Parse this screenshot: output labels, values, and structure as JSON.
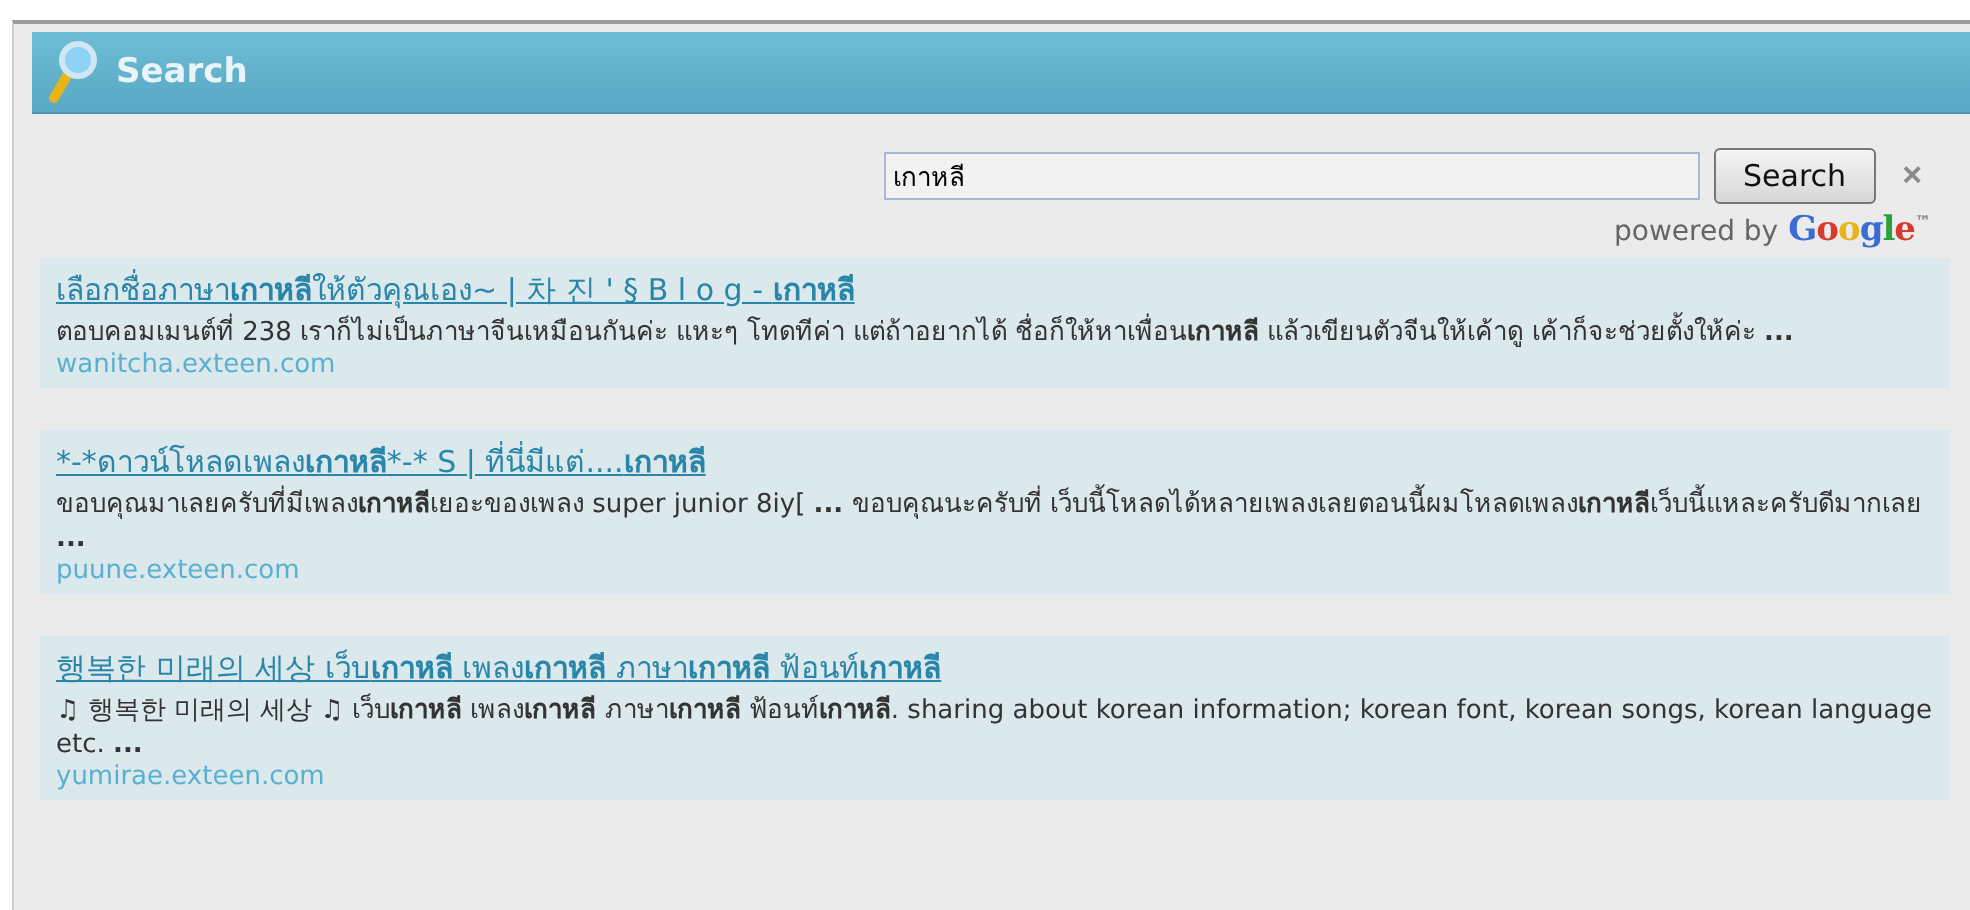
{
  "panel": {
    "title": "Search"
  },
  "search": {
    "value": "เกาหลี",
    "button": "Search",
    "clear": "×",
    "powered_by": "powered by",
    "brand": "Google",
    "brand_mark": "™"
  },
  "results": [
    {
      "title": "เลือกชื่อภาษา**เกาหลี**ให้ตัวคุณเอง~ | 차 진 ' § B l o g - **เกาหลี**",
      "snippet": "ตอบคอมเมนต์ที่ 238 เราก็ไม่เป็นภาษาจีนเหมือนกันค่ะ แหะๆ โทดทีค่า แต่ถ้าอยากได้ ชื่อก็ให้หาเพื่อน**เกาหลี** แล้วเขียนตัวจีนให้เค้าดู เค้าก็จะช่วยตั้งให้ค่ะ **...**",
      "url": "wanitcha.exteen.com"
    },
    {
      "title": "*-*ดาวน์โหลดเพลง**เกาหลี***-* S | ที่นี่มีแต่....**เกาหลี**",
      "snippet": "ขอบคุณมาเลยครับที่มีเพลง**เกาหลี**เยอะของเพลง super junior 8iy[ **...** ขอบคุณนะครับที่ เว็บนี้โหลดได้หลายเพลงเลยตอนนี้ผมโหลดเพลง**เกาหลี**เว็บนี้แหละครับดีมากเลย **...**",
      "url": "puune.exteen.com"
    },
    {
      "title": "행복한 미래의 세상 เว็บ**เกาหลี** เพลง**เกาหลี** ภาษา**เกาหลี** ฟ้อนท์**เกาหลี**",
      "snippet": "♫ 행복한 미래의 세상 ♫ เว็บ**เกาหลี** เพลง**เกาหลี** ภาษา**เกาหลี** ฟ้อนท์**เกาหลี**. sharing about korean information; korean font, korean songs, korean language etc. **...**",
      "url": "yumirae.exteen.com"
    }
  ]
}
